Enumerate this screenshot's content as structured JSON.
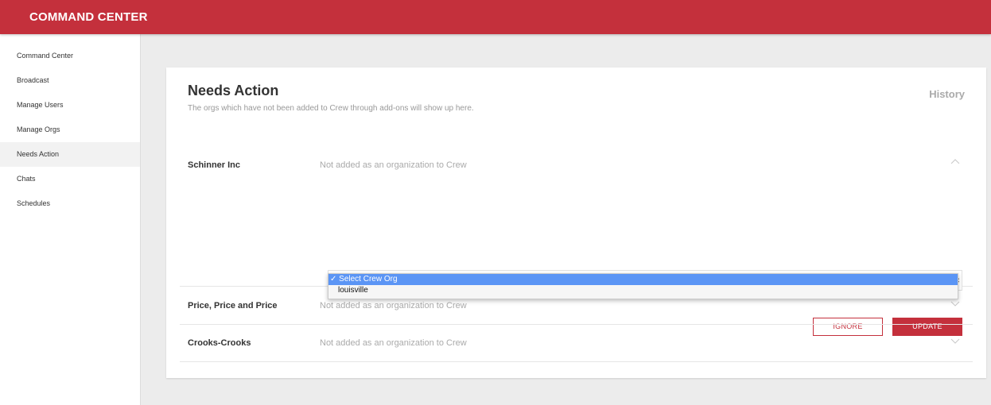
{
  "app": {
    "title": "COMMAND CENTER"
  },
  "sidebar": {
    "items": [
      {
        "label": "Command Center"
      },
      {
        "label": "Broadcast"
      },
      {
        "label": "Manage Users"
      },
      {
        "label": "Manage Orgs"
      },
      {
        "label": "Needs Action",
        "active": true
      },
      {
        "label": "Chats"
      },
      {
        "label": "Schedules"
      }
    ]
  },
  "main": {
    "title": "Needs Action",
    "subtitle": "The orgs which have not been added to Crew through add-ons will show up here.",
    "history_label": "History",
    "orgs": [
      {
        "name": "Schinner Inc",
        "status": "Not added as an organization to Crew",
        "expanded": true,
        "select": {
          "options": [
            "Select Crew Org",
            "louisville"
          ],
          "selected": "Select Crew Org",
          "selected_display": "✓ Select Crew Org"
        },
        "ignore_label": "IGNORE",
        "update_label": "UPDATE"
      },
      {
        "name": "Price, Price and Price",
        "status": "Not added as an organization to Crew",
        "expanded": false
      },
      {
        "name": "Crooks-Crooks",
        "status": "Not added as an organization to Crew",
        "expanded": false
      }
    ]
  },
  "colors": {
    "brand": "#c4303c",
    "selected_option": "#5b95f5",
    "background": "#ececec"
  },
  "icons": {
    "expanded": "chevron-up-icon",
    "collapsed": "chevron-down-icon",
    "select_arrows": "select-arrows-icon"
  }
}
